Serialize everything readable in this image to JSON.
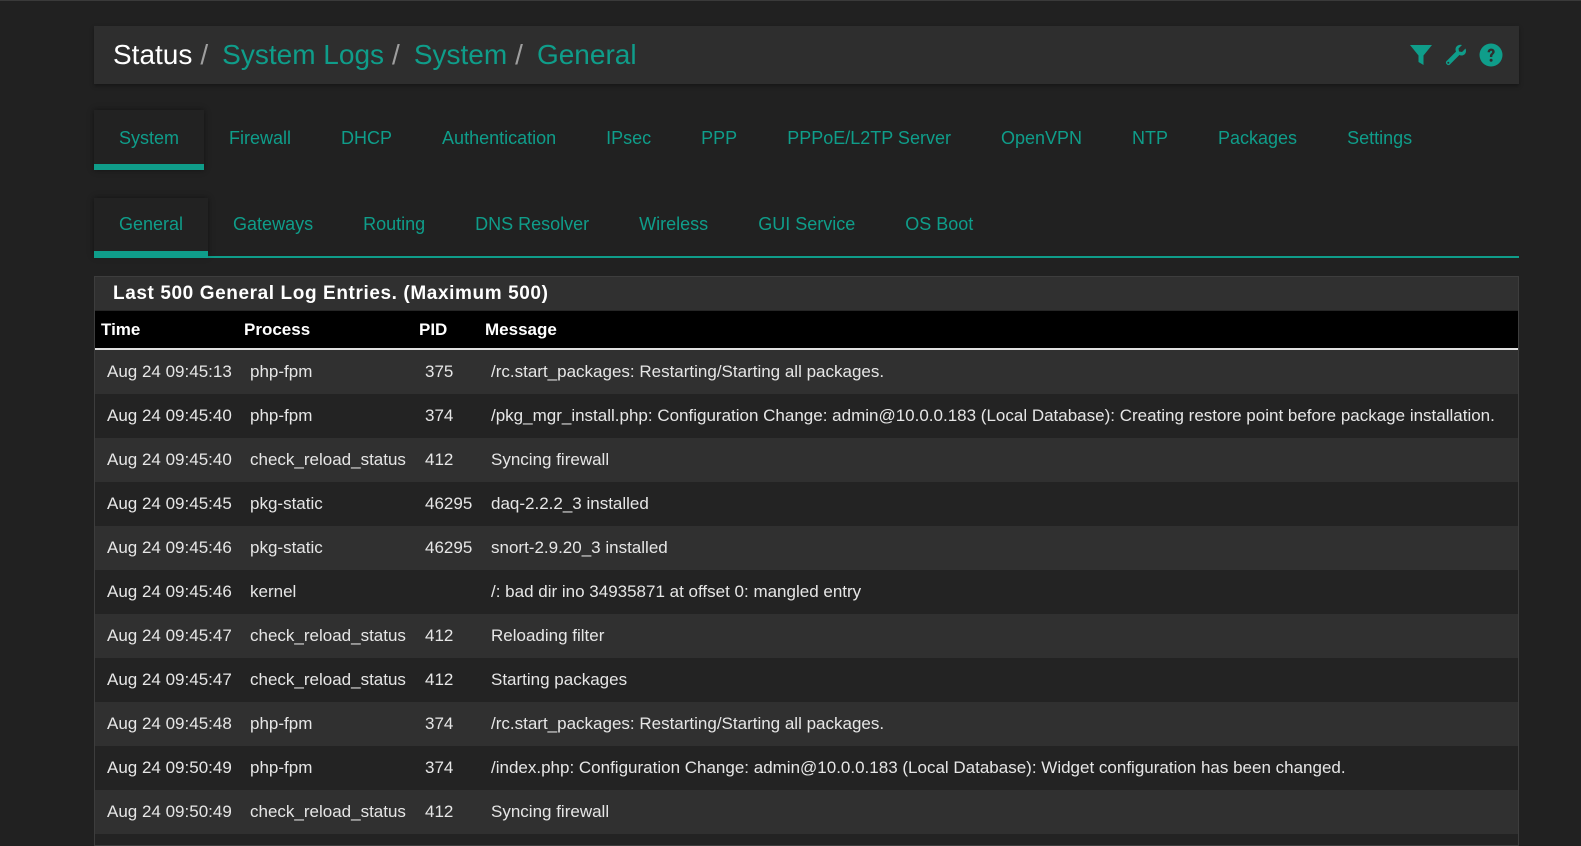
{
  "breadcrumb": {
    "root": "Status",
    "separator": "/",
    "links": [
      "System Logs",
      "System",
      "General"
    ]
  },
  "header_icons": [
    "filter-icon",
    "wrench-icon",
    "help-icon"
  ],
  "primary_tabs": [
    {
      "label": "System",
      "active": true
    },
    {
      "label": "Firewall",
      "active": false
    },
    {
      "label": "DHCP",
      "active": false
    },
    {
      "label": "Authentication",
      "active": false
    },
    {
      "label": "IPsec",
      "active": false
    },
    {
      "label": "PPP",
      "active": false
    },
    {
      "label": "PPPoE/L2TP Server",
      "active": false
    },
    {
      "label": "OpenVPN",
      "active": false
    },
    {
      "label": "NTP",
      "active": false
    },
    {
      "label": "Packages",
      "active": false
    },
    {
      "label": "Settings",
      "active": false
    }
  ],
  "secondary_tabs": [
    {
      "label": "General",
      "active": true
    },
    {
      "label": "Gateways",
      "active": false
    },
    {
      "label": "Routing",
      "active": false
    },
    {
      "label": "DNS Resolver",
      "active": false
    },
    {
      "label": "Wireless",
      "active": false
    },
    {
      "label": "GUI Service",
      "active": false
    },
    {
      "label": "OS Boot",
      "active": false
    }
  ],
  "panel": {
    "title": "Last 500 General Log Entries. (Maximum 500)",
    "columns": [
      "Time",
      "Process",
      "PID",
      "Message"
    ],
    "rows": [
      {
        "time": "Aug 24 09:45:13",
        "process": "php-fpm",
        "pid": "375",
        "message": "/rc.start_packages: Restarting/Starting all packages."
      },
      {
        "time": "Aug 24 09:45:40",
        "process": "php-fpm",
        "pid": "374",
        "message": "/pkg_mgr_install.php: Configuration Change: admin@10.0.0.183 (Local Database): Creating restore point before package installation."
      },
      {
        "time": "Aug 24 09:45:40",
        "process": "check_reload_status",
        "pid": "412",
        "message": "Syncing firewall"
      },
      {
        "time": "Aug 24 09:45:45",
        "process": "pkg-static",
        "pid": "46295",
        "message": "daq-2.2.2_3 installed"
      },
      {
        "time": "Aug 24 09:45:46",
        "process": "pkg-static",
        "pid": "46295",
        "message": "snort-2.9.20_3 installed"
      },
      {
        "time": "Aug 24 09:45:46",
        "process": "kernel",
        "pid": "",
        "message": "/: bad dir ino 34935871 at offset 0: mangled entry"
      },
      {
        "time": "Aug 24 09:45:47",
        "process": "check_reload_status",
        "pid": "412",
        "message": "Reloading filter"
      },
      {
        "time": "Aug 24 09:45:47",
        "process": "check_reload_status",
        "pid": "412",
        "message": "Starting packages"
      },
      {
        "time": "Aug 24 09:45:48",
        "process": "php-fpm",
        "pid": "374",
        "message": "/rc.start_packages: Restarting/Starting all packages."
      },
      {
        "time": "Aug 24 09:50:49",
        "process": "php-fpm",
        "pid": "374",
        "message": "/index.php: Configuration Change: admin@10.0.0.183 (Local Database): Widget configuration has been changed."
      },
      {
        "time": "Aug 24 09:50:49",
        "process": "check_reload_status",
        "pid": "412",
        "message": "Syncing firewall"
      },
      {
        "time": "",
        "process": "",
        "pid": "",
        "message": ""
      }
    ]
  },
  "colors": {
    "accent": "#0f9d8a",
    "background": "#212121",
    "header_bg": "#2e2e2e",
    "table_header_bg": "#000000"
  }
}
